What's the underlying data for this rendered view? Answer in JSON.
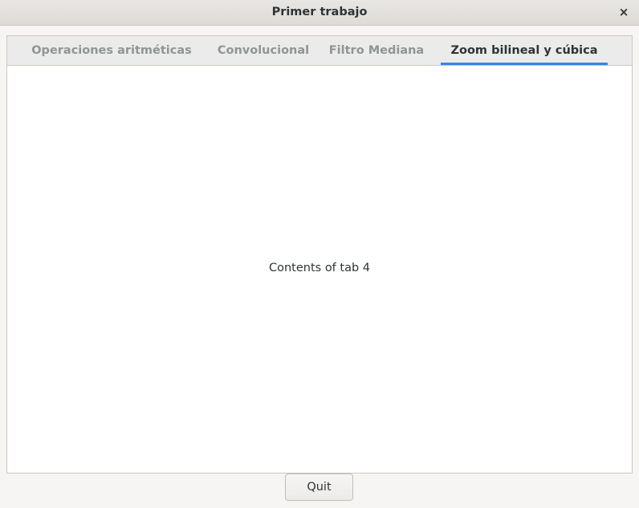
{
  "window": {
    "title": "Primer trabajo",
    "close_icon": "×"
  },
  "tabs": [
    {
      "label": "Operaciones aritméticas",
      "active": false
    },
    {
      "label": "Convolucional",
      "active": false
    },
    {
      "label": "Filtro Mediana",
      "active": false
    },
    {
      "label": "Zoom bilineal y cúbica",
      "active": true
    }
  ],
  "content": {
    "text": "Contents of tab 4"
  },
  "footer": {
    "quit_label": "Quit"
  },
  "colors": {
    "accent": "#3584e4",
    "text": "#2e3436",
    "inactive_tab_text": "#919494"
  }
}
